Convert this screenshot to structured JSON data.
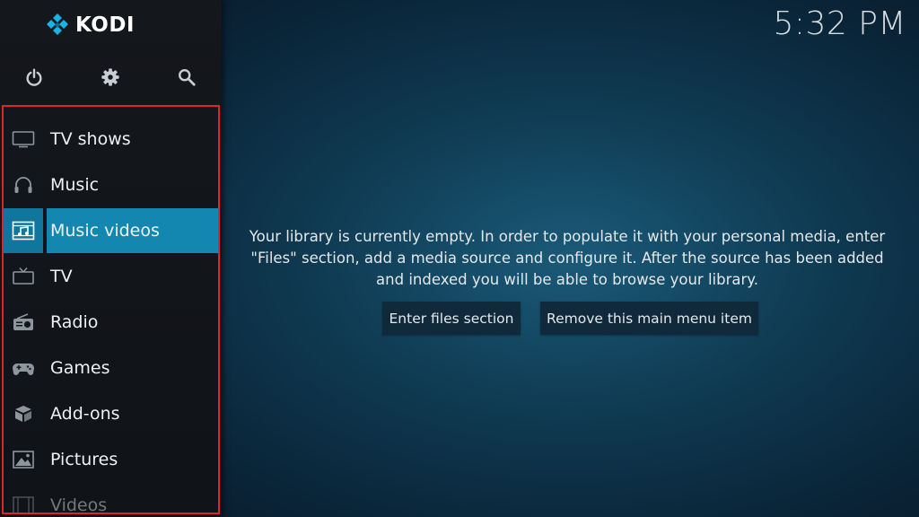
{
  "app": {
    "name": "KODI"
  },
  "clock": {
    "time": "5:32 PM"
  },
  "top_icons": [
    {
      "icon": "power-icon"
    },
    {
      "icon": "gear-icon"
    },
    {
      "icon": "search-icon"
    }
  ],
  "menu": {
    "items": [
      {
        "label": "TV shows",
        "icon": "tv-shows-icon",
        "active": false
      },
      {
        "label": "Music",
        "icon": "headphones-icon",
        "active": false
      },
      {
        "label": "Music videos",
        "icon": "music-video-icon",
        "active": true
      },
      {
        "label": "TV",
        "icon": "tv-icon",
        "active": false
      },
      {
        "label": "Radio",
        "icon": "radio-icon",
        "active": false
      },
      {
        "label": "Games",
        "icon": "gamepad-icon",
        "active": false
      },
      {
        "label": "Add-ons",
        "icon": "addons-box-icon",
        "active": false
      },
      {
        "label": "Pictures",
        "icon": "pictures-icon",
        "active": false
      },
      {
        "label": "Videos",
        "icon": "film-icon",
        "active": false
      }
    ]
  },
  "main": {
    "message_line1": "Your library is currently empty. In order to populate it with your personal media, enter",
    "message_line2": "\"Files\" section, add a media source and configure it. After the source has been added",
    "message_line3": "and indexed you will be able to browse your library.",
    "buttons": {
      "enter_files": "Enter files section",
      "remove_item": "Remove this main menu item"
    }
  },
  "colors": {
    "highlight": "#1387b0",
    "highlight_icon": "#10769e",
    "annotation_border": "#e0232c",
    "logo_blue": "#17b2e7"
  }
}
